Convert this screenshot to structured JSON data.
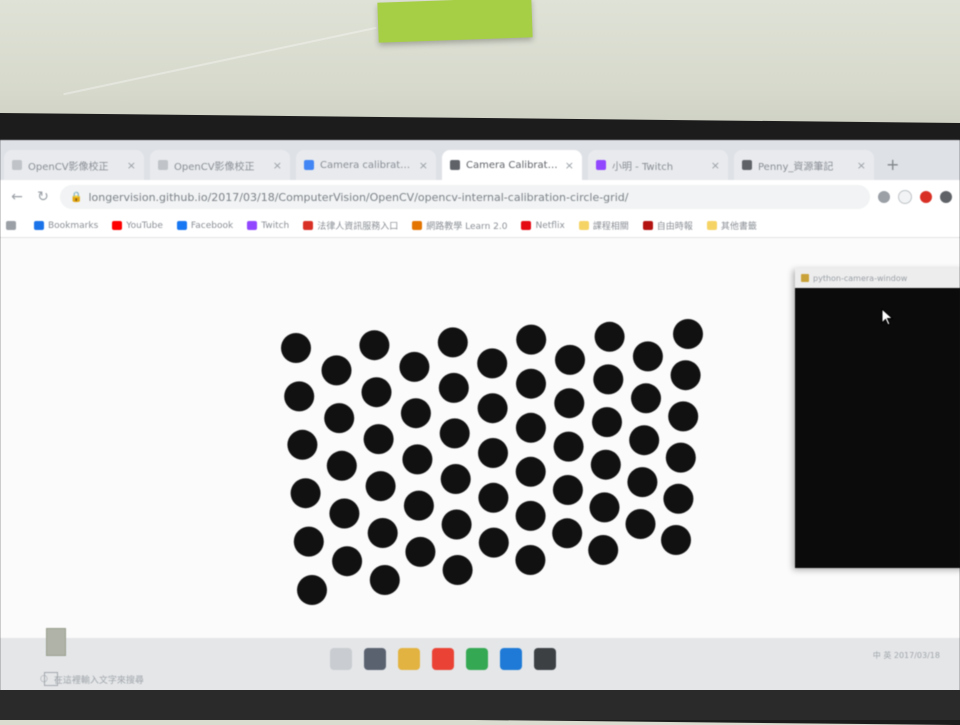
{
  "tabs": [
    {
      "label": "OpenCV影像校正",
      "favicon_color": "#c0c4c8"
    },
    {
      "label": "OpenCV影像校正",
      "favicon_color": "#c0c4c8"
    },
    {
      "label": "Camera calibration",
      "favicon_color": "#4285f4"
    },
    {
      "label": "Camera Calibration",
      "favicon_color": "#5f6368"
    },
    {
      "label": "小明 - Twitch",
      "favicon_color": "#9146ff"
    },
    {
      "label": "Penny_資源筆記",
      "favicon_color": "#5f6368"
    }
  ],
  "active_tab_index": 3,
  "new_tab_symbol": "+",
  "address_bar": {
    "url": "longervision.github.io/2017/03/18/ComputerVision/OpenCV/opencv-internal-calibration-circle-grid/"
  },
  "bookmarks": [
    {
      "label": "",
      "icon_color": "#9aa0a6"
    },
    {
      "label": "Bookmarks",
      "icon_color": "#1a73e8"
    },
    {
      "label": "YouTube",
      "icon_color": "#ff0000"
    },
    {
      "label": "Facebook",
      "icon_color": "#1877f2"
    },
    {
      "label": "Twitch",
      "icon_color": "#9146ff"
    },
    {
      "label": "法律人資訊服務入口",
      "icon_color": "#d93025"
    },
    {
      "label": "網路教學 Learn 2.0",
      "icon_color": "#e37400"
    },
    {
      "label": "Netflix",
      "icon_color": "#e50914"
    },
    {
      "label": "課程相關",
      "icon_color": "#f6d365"
    },
    {
      "label": "自由時報",
      "icon_color": "#b31412"
    },
    {
      "label": "其他書籤",
      "icon_color": "#f6d365"
    }
  ],
  "side_window": {
    "title": "python-camera-window"
  },
  "taskbar": {
    "search_placeholder": "在這裡輸入文字來搜尋",
    "app_icons": [
      "#c9ccd0",
      "#5a6270",
      "#e3b341",
      "#ea4335",
      "#34a853",
      "#1e7ad6",
      "#3c4043"
    ],
    "tray_text": "中 英 2017/03/18"
  },
  "calibration_pattern": {
    "type": "asymmetric-circle-grid",
    "dot_color": "#111111",
    "columns": 11,
    "rows": 8
  }
}
